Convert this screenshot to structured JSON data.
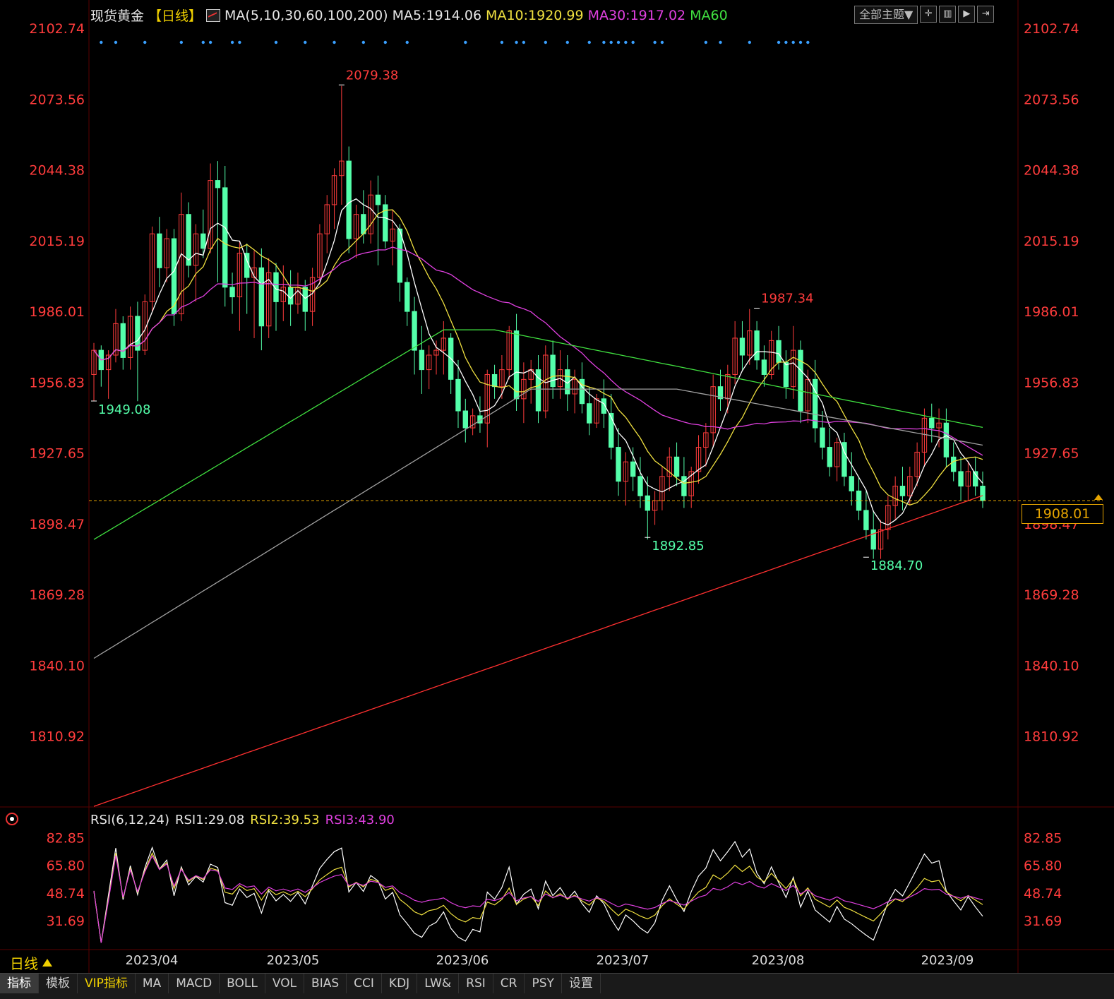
{
  "header": {
    "symbol": "现货黄金",
    "period": "【日线】",
    "ma_label": "MA(5,10,30,60,100,200)",
    "ma5": "MA5:1914.06",
    "ma10": "MA10:1920.99",
    "ma30": "MA30:1917.02",
    "ma60": "MA60"
  },
  "toolbar": {
    "theme_label": "全部主题▼"
  },
  "rsi_header": {
    "label": "RSI(6,12,24)",
    "rsi1": "RSI1:29.08",
    "rsi2": "RSI2:39.53",
    "rsi3": "RSI3:43.90"
  },
  "current_price": "1908.01",
  "period_selector": "日线",
  "bottom_tabs": [
    "指标",
    "模板",
    "VIP指标",
    "MA",
    "MACD",
    "BOLL",
    "VOL",
    "BIAS",
    "CCI",
    "KDJ",
    "LW&",
    "RSI",
    "CR",
    "PSY",
    "设置"
  ],
  "colors": {
    "up": "#ff3c3c",
    "down": "#54ffaa",
    "ma5": "#ffffff",
    "ma10": "#f0e040",
    "ma30": "#e040e0",
    "ma60": "#40e040",
    "ma100": "#a0a0a0",
    "ma200": "#ff3030",
    "axis_label": "#ff3c3c"
  },
  "chart_data": [
    {
      "type": "candlestick",
      "title": "现货黄金【日线】",
      "y_ticks": [
        "2102.74",
        "2073.56",
        "2044.38",
        "2015.19",
        "1986.01",
        "1956.83",
        "1927.65",
        "1898.47",
        "1869.28",
        "1840.10",
        "1810.92"
      ],
      "ylim": [
        1781.74,
        2102.74
      ],
      "x_ticks": [
        "2023/04",
        "2023/05",
        "2023/06",
        "2023/07",
        "2023/08",
        "2023/09"
      ],
      "annotations": [
        {
          "label": "2079.38",
          "date": "2023-05-04",
          "value": 2079.38,
          "color": "#ff3c3c"
        },
        {
          "label": "1949.08",
          "date": "2023-03-20",
          "value": 1949.08,
          "color": "#54ffaa"
        },
        {
          "label": "1987.34",
          "date": "2023-07-20",
          "value": 1987.34,
          "color": "#ff3c3c"
        },
        {
          "label": "1892.85",
          "date": "2023-06-29",
          "value": 1892.85,
          "color": "#54ffaa"
        },
        {
          "label": "1884.70",
          "date": "2023-08-21",
          "value": 1884.7,
          "color": "#54ffaa"
        }
      ],
      "current_price_line": 1908.01,
      "candles": [
        [
          1960,
          1973,
          1949,
          1970
        ],
        [
          1970,
          1972,
          1955,
          1962
        ],
        [
          1962,
          1970,
          1950,
          1968
        ],
        [
          1968,
          1987,
          1965,
          1981
        ],
        [
          1981,
          1984,
          1962,
          1967
        ],
        [
          1967,
          1988,
          1962,
          1984
        ],
        [
          1984,
          1990,
          1949,
          1970
        ],
        [
          1970,
          1993,
          1968,
          1990
        ],
        [
          1990,
          2021,
          1986,
          2018
        ],
        [
          2018,
          2025,
          1996,
          2004
        ],
        [
          2004,
          2020,
          1998,
          2016
        ],
        [
          2016,
          2020,
          1980,
          1985
        ],
        [
          1985,
          2035,
          1982,
          2026
        ],
        [
          2026,
          2031,
          2000,
          2005
        ],
        [
          2005,
          2022,
          1990,
          2018
        ],
        [
          2018,
          2028,
          2008,
          2012
        ],
        [
          2012,
          2047,
          2010,
          2040
        ],
        [
          2040,
          2048,
          1998,
          2037
        ],
        [
          2037,
          2046,
          1988,
          1996
        ],
        [
          1996,
          2002,
          1985,
          1992
        ],
        [
          1992,
          2015,
          1978,
          2010
        ],
        [
          2010,
          2014,
          1985,
          2000
        ],
        [
          2000,
          2011,
          1975,
          2004
        ],
        [
          2004,
          2012,
          1970,
          1980
        ],
        [
          1980,
          2008,
          1975,
          2002
        ],
        [
          2002,
          2006,
          1978,
          1990
        ],
        [
          1990,
          2005,
          1982,
          1996
        ],
        [
          1996,
          2003,
          1980,
          1989
        ],
        [
          1989,
          2002,
          1985,
          1996
        ],
        [
          1996,
          1999,
          1978,
          1986
        ],
        [
          1986,
          2004,
          1980,
          2000
        ],
        [
          2000,
          2022,
          1997,
          2018
        ],
        [
          2018,
          2034,
          2010,
          2030
        ],
        [
          2030,
          2045,
          2020,
          2042
        ],
        [
          2042,
          2079,
          2030,
          2048
        ],
        [
          2048,
          2054,
          2010,
          2016
        ],
        [
          2016,
          2030,
          2008,
          2026
        ],
        [
          2026,
          2036,
          2014,
          2018
        ],
        [
          2018,
          2040,
          2014,
          2034
        ],
        [
          2034,
          2042,
          2005,
          2030
        ],
        [
          2030,
          2034,
          2012,
          2015
        ],
        [
          2015,
          2028,
          2005,
          2020
        ],
        [
          2020,
          2022,
          1990,
          1998
        ],
        [
          1998,
          2000,
          1980,
          1986
        ],
        [
          1986,
          1992,
          1960,
          1970
        ],
        [
          1970,
          1980,
          1952,
          1962
        ],
        [
          1962,
          1972,
          1954,
          1968
        ],
        [
          1968,
          1974,
          1960,
          1970
        ],
        [
          1970,
          1982,
          1960,
          1975
        ],
        [
          1975,
          1977,
          1952,
          1958
        ],
        [
          1958,
          1966,
          1938,
          1945
        ],
        [
          1945,
          1950,
          1932,
          1938
        ],
        [
          1938,
          1946,
          1935,
          1943
        ],
        [
          1943,
          1951,
          1936,
          1940
        ],
        [
          1940,
          1962,
          1930,
          1960
        ],
        [
          1960,
          1964,
          1950,
          1955
        ],
        [
          1955,
          1968,
          1950,
          1962
        ],
        [
          1962,
          1980,
          1958,
          1978
        ],
        [
          1978,
          1985,
          1945,
          1950
        ],
        [
          1950,
          1965,
          1940,
          1958
        ],
        [
          1958,
          1966,
          1948,
          1962
        ],
        [
          1962,
          1968,
          1940,
          1945
        ],
        [
          1945,
          1972,
          1942,
          1968
        ],
        [
          1968,
          1974,
          1950,
          1955
        ],
        [
          1955,
          1970,
          1950,
          1962
        ],
        [
          1962,
          1968,
          1945,
          1952
        ],
        [
          1952,
          1962,
          1944,
          1958
        ],
        [
          1958,
          1965,
          1944,
          1948
        ],
        [
          1948,
          1955,
          1935,
          1940
        ],
        [
          1940,
          1952,
          1938,
          1950
        ],
        [
          1950,
          1958,
          1938,
          1944
        ],
        [
          1944,
          1952,
          1925,
          1930
        ],
        [
          1930,
          1938,
          1910,
          1916
        ],
        [
          1916,
          1928,
          1906,
          1924
        ],
        [
          1924,
          1930,
          1912,
          1918
        ],
        [
          1918,
          1926,
          1905,
          1910
        ],
        [
          1910,
          1918,
          1892,
          1904
        ],
        [
          1904,
          1912,
          1898,
          1908
        ],
        [
          1908,
          1922,
          1904,
          1918
        ],
        [
          1918,
          1930,
          1912,
          1926
        ],
        [
          1926,
          1932,
          1914,
          1918
        ],
        [
          1918,
          1926,
          1905,
          1910
        ],
        [
          1910,
          1922,
          1905,
          1920
        ],
        [
          1920,
          1935,
          1915,
          1930
        ],
        [
          1930,
          1940,
          1922,
          1936
        ],
        [
          1936,
          1960,
          1930,
          1955
        ],
        [
          1955,
          1962,
          1945,
          1950
        ],
        [
          1950,
          1964,
          1944,
          1960
        ],
        [
          1960,
          1982,
          1956,
          1975
        ],
        [
          1975,
          1982,
          1962,
          1968
        ],
        [
          1968,
          1987,
          1964,
          1978
        ],
        [
          1978,
          1982,
          1962,
          1966
        ],
        [
          1966,
          1972,
          1955,
          1960
        ],
        [
          1960,
          1978,
          1958,
          1974
        ],
        [
          1974,
          1980,
          1962,
          1965
        ],
        [
          1965,
          1970,
          1950,
          1955
        ],
        [
          1955,
          1980,
          1950,
          1970
        ],
        [
          1970,
          1974,
          1940,
          1945
        ],
        [
          1945,
          1962,
          1940,
          1958
        ],
        [
          1958,
          1966,
          1932,
          1938
        ],
        [
          1938,
          1945,
          1925,
          1930
        ],
        [
          1930,
          1938,
          1918,
          1922
        ],
        [
          1922,
          1934,
          1916,
          1932
        ],
        [
          1932,
          1936,
          1914,
          1918
        ],
        [
          1918,
          1928,
          1906,
          1912
        ],
        [
          1912,
          1918,
          1900,
          1904
        ],
        [
          1904,
          1912,
          1892,
          1896
        ],
        [
          1896,
          1904,
          1884,
          1888
        ],
        [
          1888,
          1900,
          1884,
          1896
        ],
        [
          1896,
          1910,
          1892,
          1906
        ],
        [
          1906,
          1918,
          1900,
          1914
        ],
        [
          1914,
          1922,
          1904,
          1910
        ],
        [
          1910,
          1922,
          1906,
          1918
        ],
        [
          1918,
          1932,
          1914,
          1928
        ],
        [
          1928,
          1946,
          1922,
          1942
        ],
        [
          1942,
          1948,
          1932,
          1938
        ],
        [
          1938,
          1946,
          1930,
          1940
        ],
        [
          1940,
          1946,
          1922,
          1926
        ],
        [
          1926,
          1932,
          1916,
          1920
        ],
        [
          1920,
          1926,
          1908,
          1914
        ],
        [
          1914,
          1924,
          1908,
          1920
        ],
        [
          1920,
          1926,
          1910,
          1914
        ],
        [
          1914,
          1920,
          1905,
          1908
        ]
      ],
      "series": [
        {
          "name": "MA5",
          "color": "#ffffff"
        },
        {
          "name": "MA10",
          "color": "#f0e040"
        },
        {
          "name": "MA30",
          "color": "#e040e0"
        },
        {
          "name": "MA60",
          "color": "#40e040"
        },
        {
          "name": "MA100",
          "color": "#a0a0a0"
        },
        {
          "name": "MA200",
          "color": "#ff3030"
        }
      ]
    },
    {
      "type": "line",
      "title": "RSI(6,12,24)",
      "y_ticks": [
        "82.85",
        "65.80",
        "48.74",
        "31.69"
      ],
      "ylim": [
        16,
        90
      ],
      "series": [
        {
          "name": "RSI1",
          "color": "#ffffff"
        },
        {
          "name": "RSI2",
          "color": "#f0e040"
        },
        {
          "name": "RSI3",
          "color": "#e040e0"
        }
      ]
    }
  ]
}
